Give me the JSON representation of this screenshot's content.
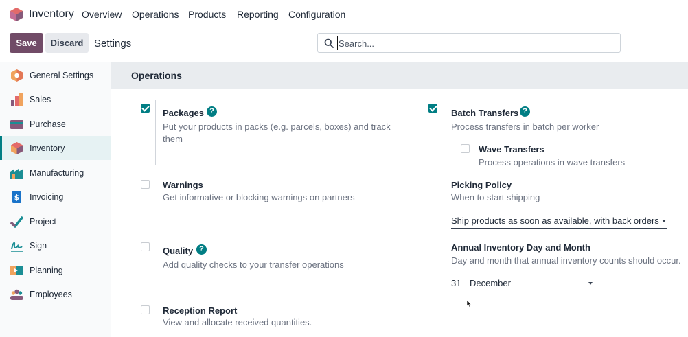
{
  "app": {
    "name": "Inventory"
  },
  "menu": [
    "Overview",
    "Operations",
    "Products",
    "Reporting",
    "Configuration"
  ],
  "control": {
    "save": "Save",
    "discard": "Discard",
    "breadcrumb": "Settings",
    "search_placeholder": "Search..."
  },
  "sidebar": {
    "items": [
      {
        "label": "General Settings",
        "icon": "general-settings-icon"
      },
      {
        "label": "Sales",
        "icon": "sales-icon"
      },
      {
        "label": "Purchase",
        "icon": "purchase-icon"
      },
      {
        "label": "Inventory",
        "icon": "inventory-icon",
        "active": true
      },
      {
        "label": "Manufacturing",
        "icon": "manufacturing-icon"
      },
      {
        "label": "Invoicing",
        "icon": "invoicing-icon"
      },
      {
        "label": "Project",
        "icon": "project-icon"
      },
      {
        "label": "Sign",
        "icon": "sign-icon"
      },
      {
        "label": "Planning",
        "icon": "planning-icon"
      },
      {
        "label": "Employees",
        "icon": "employees-icon"
      }
    ]
  },
  "section": {
    "title": "Operations"
  },
  "settings": {
    "packages": {
      "title": "Packages",
      "desc1": "Put your products in packs (e.g. parcels, boxes) and track",
      "desc2": "them",
      "checked": true
    },
    "batch": {
      "title": "Batch Transfers",
      "desc": "Process transfers in batch per worker",
      "checked": true
    },
    "wave": {
      "title": "Wave Transfers",
      "desc": "Process operations in wave transfers",
      "checked": false
    },
    "warnings": {
      "title": "Warnings",
      "desc": "Get informative or blocking warnings on partners",
      "checked": false
    },
    "picking": {
      "title": "Picking Policy",
      "desc": "When to start shipping",
      "value": "Ship products as soon as available, with back orders"
    },
    "quality": {
      "title": "Quality",
      "desc": "Add quality checks to your transfer operations",
      "checked": false
    },
    "annual": {
      "title": "Annual Inventory Day and Month",
      "desc": "Day and month that annual inventory counts should occur.",
      "day": "31",
      "month": "December"
    },
    "reception": {
      "title": "Reception Report",
      "desc": "View and allocate received quantities.",
      "checked": false
    }
  },
  "colors": {
    "brand": "#714b67",
    "accent": "#017e84",
    "header_bg": "#e9ecef"
  }
}
